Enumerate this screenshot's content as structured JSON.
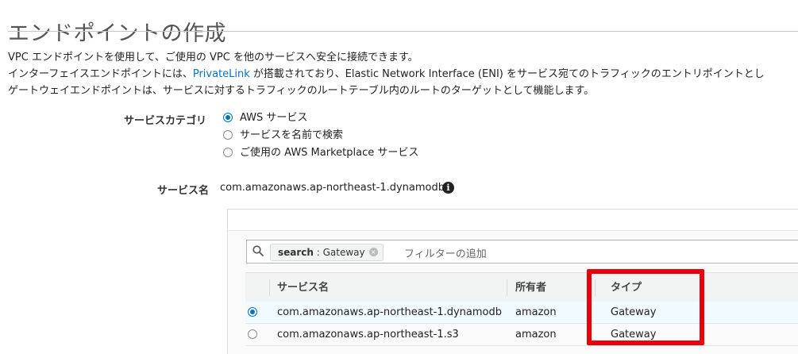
{
  "page": {
    "title": "エンドポイントの作成",
    "description": {
      "line1": "VPC エンドポイントを使用して、ご使用の VPC を他のサービスへ安全に接続できます。",
      "line2_before": "インターフェイスエンドポイントには、",
      "line2_link": "PrivateLink",
      "line2_after": " が搭載されており、Elastic Network Interface (ENI) をサービス宛てのトラフィックのエントリポイントとし",
      "line3": "ゲートウェイエンドポイントは、サービスに対するトラフィックのルートテーブル内のルートのターゲットとして機能します。"
    }
  },
  "service_category": {
    "label": "サービスカテゴリ",
    "options": [
      {
        "label": "AWS サービス",
        "selected": true
      },
      {
        "label": "サービスを名前で検索",
        "selected": false
      },
      {
        "label": "ご使用の AWS Marketplace サービス",
        "selected": false
      }
    ]
  },
  "service_name": {
    "label": "サービス名",
    "value": "com.amazonaws.ap-northeast-1.dynamodb",
    "info_icon": "i"
  },
  "filter": {
    "token_key": "search",
    "token_value": " : Gateway",
    "token_remove": "×",
    "placeholder": "フィルターの追加"
  },
  "table": {
    "columns": [
      "サービス名",
      "所有者",
      "タイプ"
    ],
    "rows": [
      {
        "service": "com.amazonaws.ap-northeast-1.dynamodb",
        "owner": "amazon",
        "type": "Gateway",
        "selected": true
      },
      {
        "service": "com.amazonaws.ap-northeast-1.s3",
        "owner": "amazon",
        "type": "Gateway",
        "selected": false
      }
    ]
  },
  "colors": {
    "accent": "#0073bb",
    "highlight": "#e8000b"
  }
}
